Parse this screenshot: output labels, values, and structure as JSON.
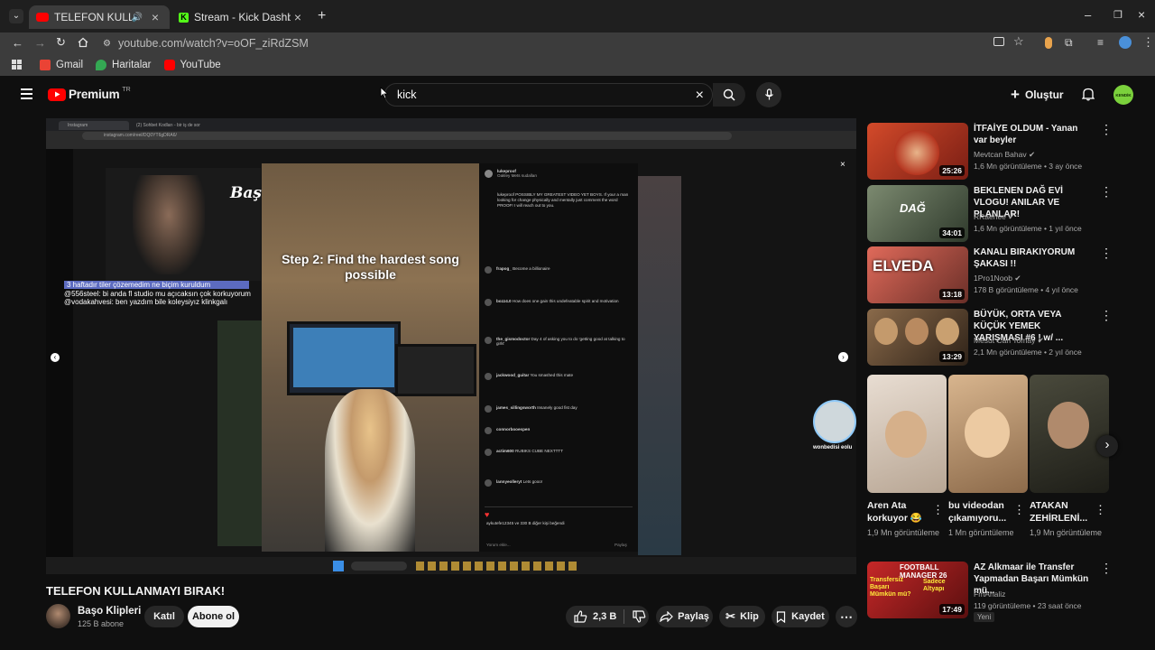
{
  "browser": {
    "tabs": [
      {
        "title": "TELEFON KULLANMAYI BIRAK!",
        "active": true
      },
      {
        "title": "Stream - Kick Dashboard",
        "active": false
      }
    ],
    "url": "youtube.com/watch?v=oOF_ziRdZSM",
    "bookmarks": [
      {
        "label": "Gmail",
        "color": "#ea4335"
      },
      {
        "label": "Haritalar",
        "color": "#34a853"
      },
      {
        "label": "YouTube",
        "color": "#ff0000"
      }
    ]
  },
  "header": {
    "logo_text": "Premium",
    "country": "TR",
    "search_value": "kick",
    "create_label": "Oluştur",
    "account_label": "KENDİK"
  },
  "player": {
    "inner_address": "instagram.com/reel/DQ0YT6gDRA6/",
    "inner_tab_1": "Instagram",
    "inner_tab_2": "(2) Sohbet Kodları - bir iş de sor",
    "chat_banner": "3 haftadır tiler çözemedim ne biçim kuruldum",
    "chat_line_1": "@556steel: bi anda fl studio mu açıcaksın çok korkuyorum",
    "chat_line_2": "@vodakahvesi: ben yazdım bile koleysiyız klinkgalı",
    "overlay_name": "Başo",
    "caption": "Step 2: Find the hardest song possible",
    "poster": "lukeproof",
    "poster_sub": "Oakley Mets sudalları",
    "post_text": "lukeproof POSSIBLY MY GREATEST VIDEO YET BOYS. If your a man looking for change physically and mentally just comment the word PROOF! I will reach out to you.",
    "comments": [
      {
        "user": "frapog_",
        "text": "Become a billionaire"
      },
      {
        "user": "bozz4.0",
        "text": "How does one gain this undefeatable spirit and motivation"
      },
      {
        "user": "the_gismodoctor",
        "text": "Day 4 of asking you to do 'getting good at talking to girls'"
      },
      {
        "user": "jackwood_guitar",
        "text": "You smashed this mate"
      },
      {
        "user": "james_sillingsworth",
        "text": "Insanely good fist day"
      },
      {
        "user": "connorbooespen",
        "text": ""
      },
      {
        "user": "actim600",
        "text": "RUBIKS CUBE NEXTTTT"
      },
      {
        "user": "lannyeolleryt",
        "text": "Lets gooo!"
      }
    ],
    "likes_line": "aykutefe12345 ve 330 B diğer kişi beğendi",
    "reply_placeholder": "Yorum ekle...",
    "share_label": "Paylaş",
    "cat_label": "wonbedisi eolu"
  },
  "video": {
    "title": "TELEFON KULLANMAYI BIRAK!",
    "channel": "Başo Klipleri",
    "subscribers": "125 B abone",
    "join_label": "Katıl",
    "subscribe_label": "Abone ol",
    "likes": "2,3 B",
    "share_label": "Paylaş",
    "clip_label": "Klip",
    "save_label": "Kaydet"
  },
  "related": [
    {
      "title": "İTFAİYE OLDUM - Yanan var beyler",
      "channel": "Mevtcan Bahav",
      "meta": "1,6 Mn görüntüleme • 3 ay önce",
      "duration": "25:26",
      "color": "#b5351f"
    },
    {
      "title": "BEKLENEN DAĞ EVİ VLOGU! ANILAR VE PLANLAR!",
      "channel": "RRaenee",
      "meta": "1,6 Mn görüntüleme • 1 yıl önce",
      "duration": "34:01",
      "color": "#4a5a48"
    },
    {
      "title": "KANALI BIRAKIYORUM ŞAKASI !!",
      "channel": "1Pro1Noob",
      "meta": "178 B görüntüleme • 4 yıl önce",
      "duration": "13:18",
      "color": "#c0564a",
      "thumb_text": "ELVEDA"
    },
    {
      "title": "BÜYÜK, ORTA VEYA KÜÇÜK YEMEK YARIŞMASI #6 ! w/ ...",
      "channel": "Mesut Can Tomay",
      "meta": "2,1 Mn görüntüleme • 2 yıl önce",
      "duration": "13:29",
      "color": "#6b4a2f"
    }
  ],
  "shorts": [
    {
      "title": "Aren Ata korkuyor 😂",
      "views": "1,9 Mn görüntüleme",
      "color": "#d9c9b8"
    },
    {
      "title": "bu videodan çıkamıyoru...",
      "views": "1 Mn görüntüleme",
      "color": "#c9a27a"
    },
    {
      "title": "ATAKAN ZEHİRLENİ...",
      "views": "1,9 Mn görüntüleme",
      "color": "#3c3d33"
    }
  ],
  "last_related": {
    "title": "AZ Alkmaar ile Transfer Yapmadan Başarı Mümkün mü...",
    "channel": "FmAnaliz",
    "meta": "119 görüntüleme • 23 saat önce",
    "badge": "Yeni",
    "duration": "17:49",
    "thumb_label": "FOOTBALL MANAGER 26",
    "thumb_question": "Transfersiz Başarı Mümkün mü?",
    "thumb_answer": "Sadece Altyapı"
  }
}
